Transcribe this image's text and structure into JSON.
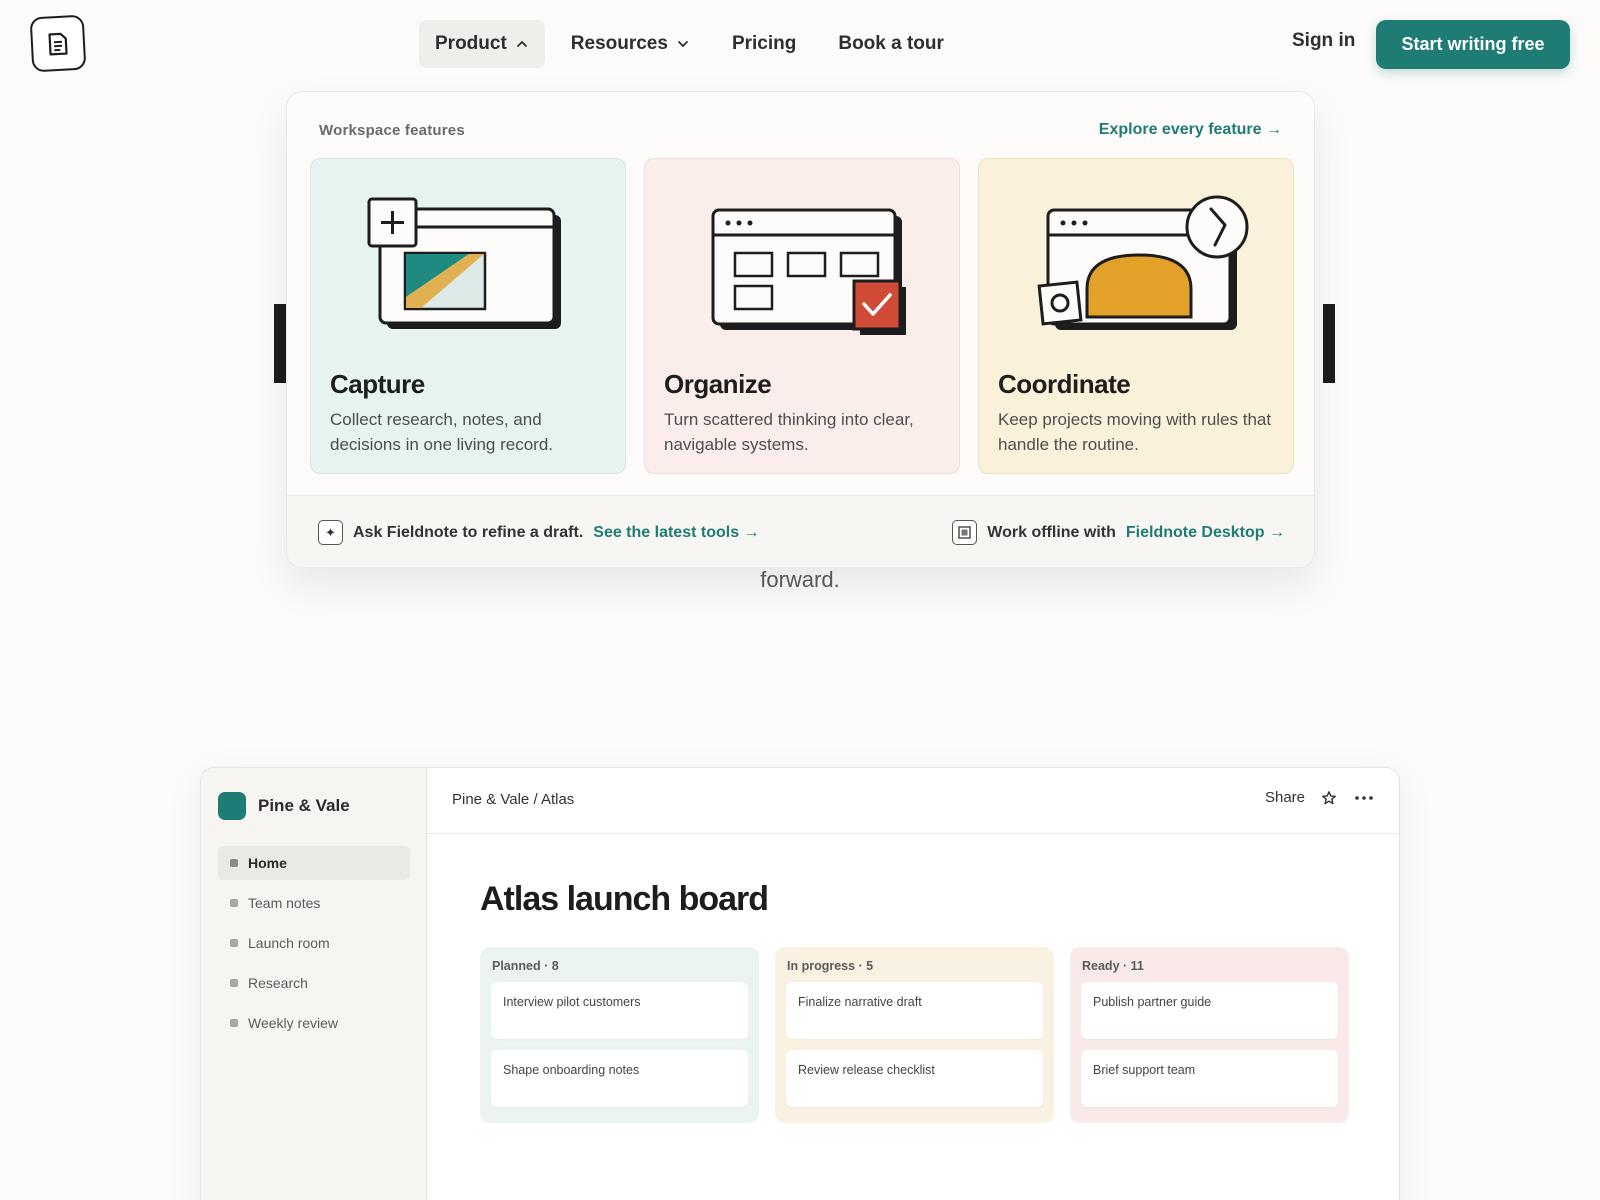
{
  "header": {
    "logo_icon": "note-document-icon",
    "nav": [
      {
        "label": "Product",
        "icon": "chevron-up-icon",
        "active": true
      },
      {
        "label": "Resources",
        "icon": "chevron-down-icon"
      },
      {
        "label": "Pricing"
      },
      {
        "label": "Book a tour"
      }
    ],
    "sign_in": "Sign in",
    "cta": "Start writing free",
    "accent_color": "#1e7c75"
  },
  "hero": {
    "visible_text": "forward."
  },
  "dropdown": {
    "heading": "Workspace features",
    "explore_link": "Explore every feature →",
    "cards": [
      {
        "title": "Capture",
        "desc": "Collect research, notes, and decisions in one living record.",
        "icon": "capture-window-illustration",
        "bg": "#e6f3f1"
      },
      {
        "title": "Organize",
        "desc": "Turn scattered thinking into clear, navigable systems.",
        "icon": "organize-grid-illustration",
        "bg": "#fbeeea"
      },
      {
        "title": "Coordinate",
        "desc": "Keep projects moving with rules that handle the routine.",
        "icon": "coordinate-clock-illustration",
        "bg": "#faf1da"
      }
    ],
    "footer": {
      "left_text": "Ask Fieldnote to refine a draft.",
      "left_link": "See the latest tools →",
      "left_icon": "sparkle-icon",
      "right_text": "Work offline with",
      "right_link": "Fieldnote Desktop →",
      "right_icon": "desktop-app-icon"
    }
  },
  "app": {
    "workspace": "Pine & Vale",
    "sidebar": [
      {
        "label": "Home",
        "active": true
      },
      {
        "label": "Team notes"
      },
      {
        "label": "Launch room"
      },
      {
        "label": "Research"
      },
      {
        "label": "Weekly review"
      }
    ],
    "breadcrumb": "Pine & Vale / Atlas",
    "share": "Share",
    "star_icon": "star-icon",
    "more_icon": "more-horizontal-icon",
    "title": "Atlas launch board",
    "columns": [
      {
        "name": "Planned · 8",
        "tasks": [
          "Interview pilot customers",
          "Shape onboarding notes"
        ]
      },
      {
        "name": "In progress · 5",
        "tasks": [
          "Finalize narrative draft",
          "Review release checklist"
        ]
      },
      {
        "name": "Ready · 11",
        "tasks": [
          "Publish partner guide",
          "Brief support team"
        ]
      }
    ]
  }
}
